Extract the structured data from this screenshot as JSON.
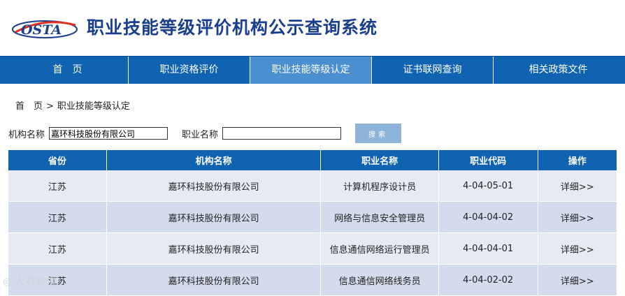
{
  "header": {
    "logo_text": "OSTA",
    "title": "职业技能等级评价机构公示查询系统"
  },
  "nav": {
    "items": [
      {
        "label": "首　页"
      },
      {
        "label": "职业资格评价"
      },
      {
        "label": "职业技能等级认定"
      },
      {
        "label": "证书联网查询"
      },
      {
        "label": "相关政策文件"
      }
    ],
    "active_index": 2
  },
  "breadcrumb": {
    "home": "首　页",
    "separator": ">",
    "current": "职业技能等级认定"
  },
  "search": {
    "org_label": "机构名称",
    "org_value": "嘉环科技股份有限公司",
    "occupation_label": "职业名称",
    "occupation_value": "",
    "button_label": "搜索"
  },
  "table": {
    "headers": [
      "省份",
      "机构名称",
      "职业名称",
      "职业代码",
      "操作"
    ],
    "rows": [
      {
        "province": "江苏",
        "org": "嘉环科技股份有限公司",
        "occupation": "计算机程序设计员",
        "code": "4-04-05-01",
        "action": "详细>>"
      },
      {
        "province": "江苏",
        "org": "嘉环科技股份有限公司",
        "occupation": "网络与信息安全管理员",
        "code": "4-04-04-02",
        "action": "详细>>"
      },
      {
        "province": "江苏",
        "org": "嘉环科技股份有限公司",
        "occupation": "信息通信网络运行管理员",
        "code": "4-04-04-01",
        "action": "详细>>"
      },
      {
        "province": "江苏",
        "org": "嘉环科技股份有限公司",
        "occupation": "信息通信网络线务员",
        "code": "4-04-02-02",
        "action": "详细>>"
      }
    ]
  },
  "watermark": "大数跨境",
  "colors": {
    "primary": "#0f63b1",
    "nav_active": "#4a8fd0",
    "title": "#1a3f8c",
    "row_odd": "#e6ebf3",
    "row_even": "#d3dcec",
    "button": "#8fb4d9"
  }
}
